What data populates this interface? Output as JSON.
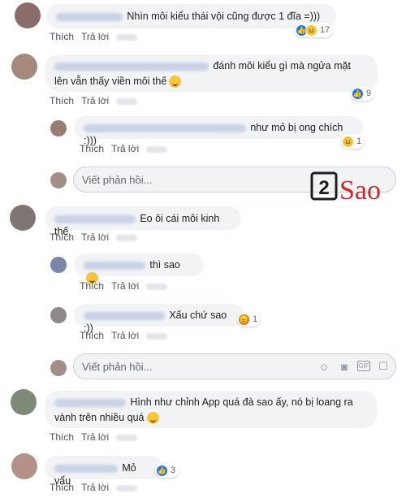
{
  "actions": {
    "like": "Thích",
    "reply": "Trả lời"
  },
  "reply_placeholder": "Viết phản hồi...",
  "comments": [
    {
      "text": "Nhìn môi kiểu thái vội cũng được 1 đĩa =)))",
      "reaction_count": "17"
    },
    {
      "text_line1": "đánh môi kiểu gì mà ngửa mặt",
      "text_line2": "lên vẫn thấy viền môi thế",
      "reaction_count": "9"
    },
    {
      "text": "như mỏ bị ong chích :)))",
      "reaction_count": "1"
    },
    {
      "text": "Eo ôi cái môi kinh thế"
    },
    {
      "text": "thì sao"
    },
    {
      "text": "Xấu chứ sao :))",
      "reaction_count": "1"
    },
    {
      "text_line1": "Hình như chỉnh App quá đà sao ấy, nó bị loang ra",
      "text_line2": "vành trên nhiều quá"
    },
    {
      "text": "Mỏ vẩu",
      "reaction_count": "3"
    }
  ],
  "watermark": {
    "number": "2",
    "word": "Sao"
  },
  "colors": {
    "like": "#1877f2",
    "haha": "#f7c43a",
    "angry": "#e9710f",
    "logo": "#d3242b"
  }
}
